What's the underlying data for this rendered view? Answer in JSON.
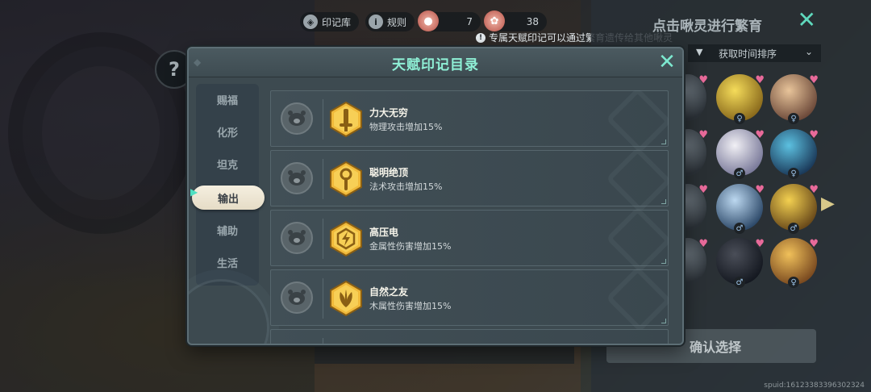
{
  "hud": {
    "imprint_library": "印记库",
    "rules": "规则",
    "resource_1": "7",
    "resource_2": "38"
  },
  "notice": "专属天赋印记可以通过繁育遗传给其他啾灵",
  "breeding_panel": {
    "title": "点击啾灵进行繁育",
    "sort_label": "获取时间排序",
    "confirm_button": "确认选择",
    "spuid": "spuid:16123383396302324"
  },
  "modal": {
    "title": "天赋印记目录",
    "tabs": [
      {
        "label": "赐福"
      },
      {
        "label": "化形"
      },
      {
        "label": "坦克"
      },
      {
        "label": "输出"
      },
      {
        "label": "辅助"
      },
      {
        "label": "生活"
      }
    ],
    "active_tab_index": 3,
    "talents": [
      {
        "name": "力大无穷",
        "desc": "物理攻击增加15%",
        "icon": "sword-icon"
      },
      {
        "name": "聪明绝顶",
        "desc": "法术攻击增加15%",
        "icon": "staff-icon"
      },
      {
        "name": "高压电",
        "desc": "金属性伤害增加15%",
        "icon": "lightning-icon"
      },
      {
        "name": "自然之友",
        "desc": "木属性伤害增加15%",
        "icon": "leaf-icon"
      }
    ]
  },
  "colors": {
    "accent": "#8ff0d6",
    "badge_gold": "#f0b93a",
    "panel": "#3d4a50"
  }
}
